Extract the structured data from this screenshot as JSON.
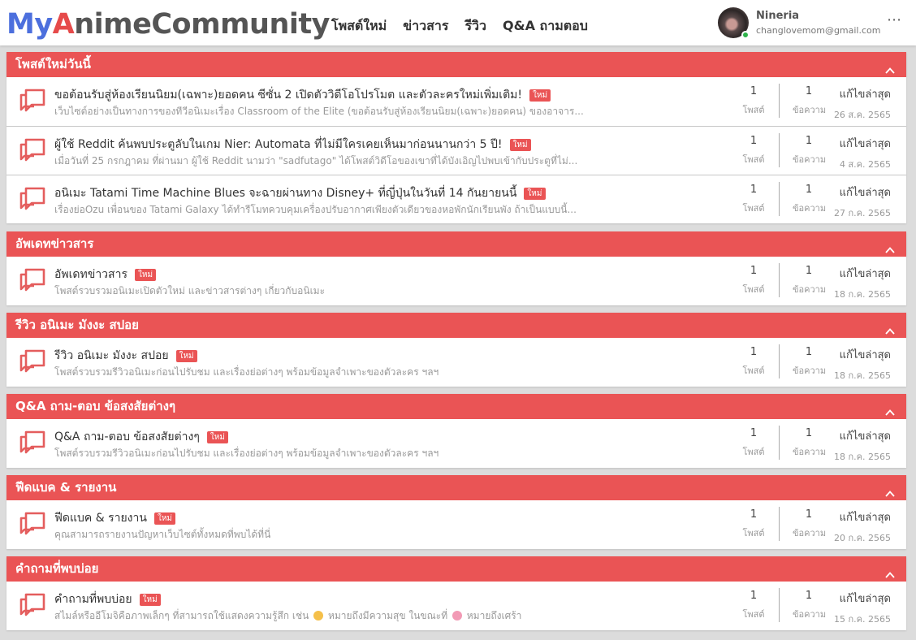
{
  "header": {
    "logo": {
      "part1": "My",
      "part2": "A",
      "part3": "nimeCommunity"
    },
    "nav": [
      "โพสต์ใหม่",
      "ข่าวสาร",
      "รีวิว",
      "Q&A ถามตอบ"
    ],
    "user": {
      "name": "Nineria",
      "email": "changlovemom@gmail.com",
      "status": "online"
    },
    "more_icon": "⋯"
  },
  "colors": {
    "accent": "#ea5455",
    "brand_blue": "#4c6fdd"
  },
  "labels": {
    "posts": "โพสต์",
    "messages": "ข้อความ",
    "last_edited": "แก้ไขล่าสุด",
    "new_badge": "ใหม่"
  },
  "sections": [
    {
      "title": "โพสต์ใหม่วันนี้",
      "rows": [
        {
          "title": "ขอต้อนรับสู่ห้องเรียนนิยม(เฉพาะ)ยอดคน ซีซั่น 2 เปิดตัววิดีโอโปรโมต และตัวละครใหม่เพิ่มเติม!",
          "desc": "เว็บไซต์อย่างเป็นทางการของทีวีอนิเมะเรื่อง Classroom of the Elite (ขอต้อนรับสู่ห้องเรียนนิยม(เฉพาะ)ยอดคน) ของอาจาร...",
          "posts": "1",
          "messages": "1",
          "date": "26 ส.ค. 2565"
        },
        {
          "title": "ผู้ใช้ Reddit ค้นพบประตูลับในเกม Nier: Automata ที่ไม่มีใครเคยเห็นมาก่อนนานกว่า 5 ปี!",
          "desc": "เมื่อวันที่ 25 กรกฎาคม ที่ผ่านมา ผู้ใช้ Reddit นามว่า \"sadfutago\" ได้โพสต์วิดีโอของเขาที่ได้บังเอิญไปพบเข้ากับประตูที่ไม่...",
          "posts": "1",
          "messages": "1",
          "date": "4 ส.ค. 2565"
        },
        {
          "title": "อนิเมะ Tatami Time Machine Blues จะฉายผ่านทาง Disney+ ที่ญี่ปุ่นในวันที่ 14 กันยายนนี้",
          "desc": "เรื่องย่อOzu เพื่อนของ Tatami Galaxy ได้ทำรีโมทควบคุมเครื่องปรับอากาศเพียงตัวเดียวของหอพักนักเรียนพัง ถ้าเป็นแบบนี้...",
          "posts": "1",
          "messages": "1",
          "date": "27 ก.ค. 2565"
        }
      ]
    },
    {
      "title": "อัพเดทข่าวสาร",
      "rows": [
        {
          "title": "อัพเดทข่าวสาร",
          "desc": "โพสต์รวบรวมอนิเมะเปิดตัวใหม่ และข่าวสารต่างๆ เกี่ยวกับอนิเมะ",
          "posts": "1",
          "messages": "1",
          "date": "18 ก.ค. 2565"
        }
      ]
    },
    {
      "title": "รีวิว อนิเมะ มังงะ สปอย",
      "rows": [
        {
          "title": "รีวิว อนิเมะ มังงะ สปอย",
          "desc": "โพสต์รวบรวมรีวิวอนิเมะก่อนไปรับชม และเรื่องย่อต่างๆ พร้อมข้อมูลจำเพาะของตัวละคร ฯลฯ",
          "posts": "1",
          "messages": "1",
          "date": "18 ก.ค. 2565"
        }
      ]
    },
    {
      "title": "Q&A ถาม-ตอบ ข้อสงสัยต่างๆ",
      "rows": [
        {
          "title": "Q&A ถาม-ตอบ ข้อสงสัยต่างๆ",
          "desc": "โพสต์รวบรวมรีวิวอนิเมะก่อนไปรับชม และเรื่องย่อต่างๆ พร้อมข้อมูลจำเพาะของตัวละคร ฯลฯ",
          "posts": "1",
          "messages": "1",
          "date": "18 ก.ค. 2565"
        }
      ]
    },
    {
      "title": "ฟีดแบค & รายงาน",
      "rows": [
        {
          "title": "ฟีดแบค & รายงาน",
          "desc": "คุณสามารถรายงานปัญหาเว็บไซต์ทั้งหมดที่พบได้ที่นี่",
          "posts": "1",
          "messages": "1",
          "date": "20 ก.ค. 2565"
        }
      ]
    },
    {
      "title": "คำถามที่พบบ่อย",
      "rows": [
        {
          "title": "คำถามที่พบบ่อย",
          "desc_parts": [
            "สไมล์หรืออีโมจิคือภาพเล็กๆ ที่สามารถใช้แสดงความรู้สึก เช่น",
            "หมายถึงมีความสุข ในขณะที่",
            "หมายถึงเศร้า"
          ],
          "emojis": [
            "happy-emoji",
            "sad-emoji"
          ],
          "posts": "1",
          "messages": "1",
          "date": "15 ก.ค. 2565"
        }
      ]
    }
  ]
}
